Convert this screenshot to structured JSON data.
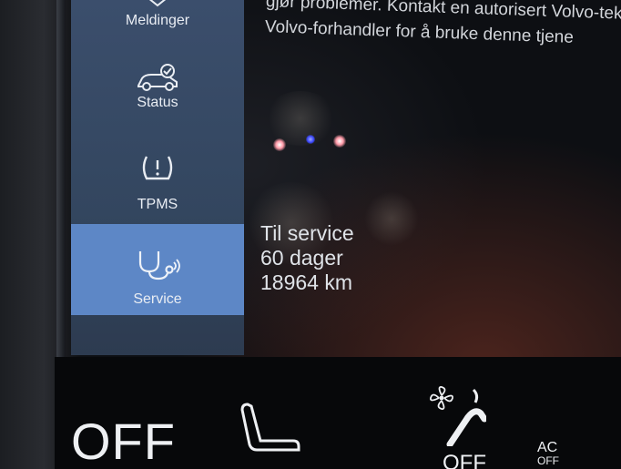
{
  "notice": {
    "line1": "gjør problemer. Kontakt en autorisert Volvo-tek",
    "line2": "Volvo-forhandler for å bruke denne tjene"
  },
  "sidebar": {
    "items": [
      {
        "label": "Meldinger",
        "icon": "messages-icon"
      },
      {
        "label": "Status",
        "icon": "car-status-icon"
      },
      {
        "label": "TPMS",
        "icon": "tire-pressure-icon"
      },
      {
        "label": "Service",
        "icon": "service-stethoscope-icon",
        "active": true
      }
    ]
  },
  "service": {
    "line1": "Til service",
    "line2": "60 dager",
    "line3": "18964 km"
  },
  "climate": {
    "left_off": "OFF",
    "right_off": "OFF",
    "ac_label": "AC",
    "ac_state": "OFF"
  },
  "colors": {
    "sidebar_bg": "#3b4e6c",
    "active_item": "#5d87c6"
  }
}
